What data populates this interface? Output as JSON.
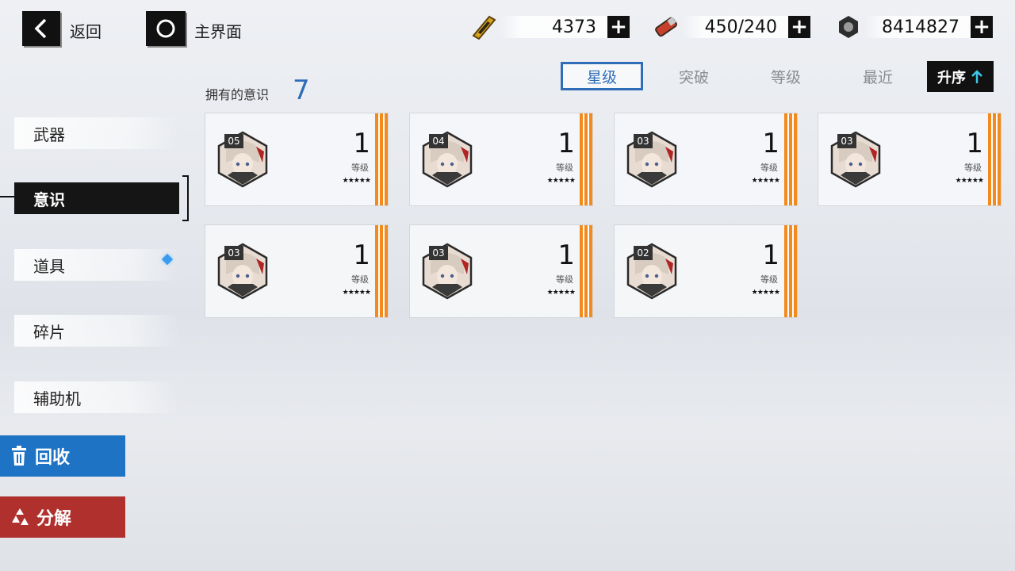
{
  "header": {
    "back_label": "返回",
    "home_label": "主界面",
    "resources": [
      {
        "icon": "gold-ticket-icon",
        "value": "4373"
      },
      {
        "icon": "energy-canister-icon",
        "value": "450/240"
      },
      {
        "icon": "hex-nut-icon",
        "value": "8414827"
      }
    ]
  },
  "sort": {
    "tabs": [
      "星级",
      "突破",
      "等级",
      "最近"
    ],
    "active_tab": "星级",
    "order_label": "升序",
    "order_icon": "arrow-up-icon"
  },
  "inventory": {
    "owned_label": "拥有的意识",
    "owned_count": "7"
  },
  "nav": {
    "items": [
      "武器",
      "意识",
      "道具",
      "碎片",
      "辅助机"
    ],
    "active": "意识"
  },
  "actions": {
    "recycle_label": "回收",
    "decompose_label": "分解"
  },
  "cards": [
    {
      "slot": "05",
      "level": "1",
      "level_label": "等级",
      "stars": "★★★★★",
      "rating": 5
    },
    {
      "slot": "04",
      "level": "1",
      "level_label": "等级",
      "stars": "★★★★★",
      "rating": 5
    },
    {
      "slot": "03",
      "level": "1",
      "level_label": "等级",
      "stars": "★★★★★",
      "rating": 5
    },
    {
      "slot": "03",
      "level": "1",
      "level_label": "等级",
      "stars": "★★★★★",
      "rating": 5
    },
    {
      "slot": "03",
      "level": "1",
      "level_label": "等级",
      "stars": "★★★★★",
      "rating": 5
    },
    {
      "slot": "03",
      "level": "1",
      "level_label": "等级",
      "stars": "★★★★★",
      "rating": 5
    },
    {
      "slot": "02",
      "level": "1",
      "level_label": "等级",
      "stars": "★★★★★",
      "rating": 5
    }
  ],
  "colors": {
    "accent_blue": "#2f6db8",
    "recycle_blue": "#1f73c4",
    "decompose_red": "#b0302e",
    "card_stripe_orange": "#f28a1e",
    "nav_dot": "#3a9bf0"
  }
}
